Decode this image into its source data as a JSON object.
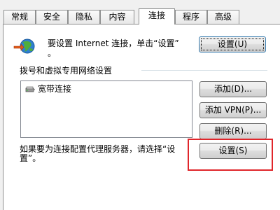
{
  "tabs": [
    {
      "label": "常规"
    },
    {
      "label": "安全"
    },
    {
      "label": "隐私"
    },
    {
      "label": "内容"
    },
    {
      "label": "连接",
      "active": true
    },
    {
      "label": "程序"
    },
    {
      "label": "高级"
    }
  ],
  "setup": {
    "line1": "要设置 Internet 连接，单击“设置”",
    "line2": "。",
    "button_label": "设置(U)"
  },
  "dialup": {
    "section_label": "拨号和虚拟专用网络设置",
    "items": [
      {
        "label": "宽带连接"
      }
    ],
    "add_label": "添加(D)...",
    "add_vpn_label": "添加 VPN(P)...",
    "remove_label": "删除(R)..."
  },
  "proxy": {
    "text_line1": "如果要为连接配置代理服务器，请选择“设",
    "text_line2": "置”。",
    "button_label": "设置(S)"
  },
  "colors": {
    "highlight": "#e0262b",
    "tab_border": "#8e8f8f"
  }
}
